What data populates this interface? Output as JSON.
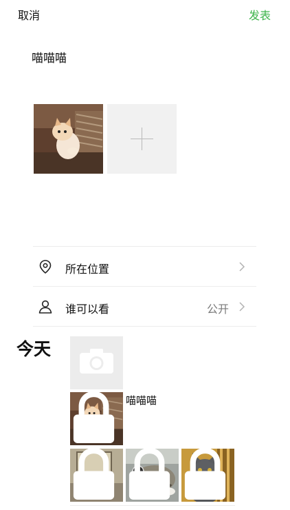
{
  "header": {
    "cancel_label": "取消",
    "publish_label": "发表"
  },
  "post": {
    "text": "喵喵喵"
  },
  "options": [
    {
      "label": "所在位置",
      "value": "",
      "icon": "location-pin-icon"
    },
    {
      "label": "谁可以看",
      "value": "公开",
      "icon": "person-icon"
    }
  ],
  "timeline": {
    "day_label": "今天",
    "entry_caption": "喵喵喵"
  },
  "colors": {
    "accent": "#3cb34a",
    "tile_background": "#f1f1f1",
    "divider": "#ececec",
    "muted_text": "#7a7a7a"
  }
}
